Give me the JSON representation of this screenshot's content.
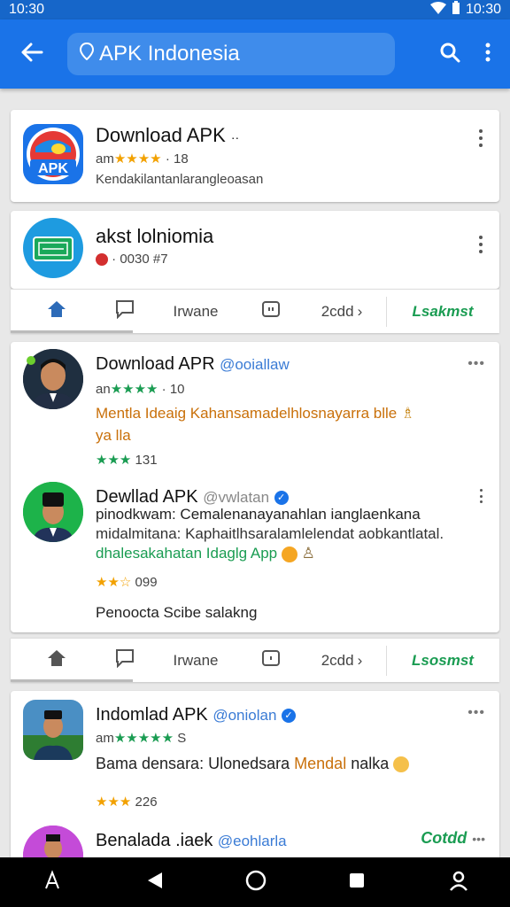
{
  "status": {
    "time_left": "10:30",
    "time_right": "10:30"
  },
  "appbar": {
    "title": "APK Indonesia"
  },
  "app_cards": [
    {
      "title": "Download APK",
      "title_suffix": "··",
      "rating_prefix": "am",
      "stars": "★★★★",
      "count": "· 18",
      "subtitle": "Kendakilantanlarangleoasan"
    },
    {
      "title": "akst lolniomia",
      "meta": "· 0030 #7"
    }
  ],
  "action_bars": [
    {
      "home": "",
      "comment": "",
      "label": "Irwane",
      "count": "2cdd",
      "green": "Lsakmst"
    },
    {
      "home": "",
      "comment": "",
      "label": "Irwane",
      "count": "2cdd",
      "green": "Lsosmst"
    }
  ],
  "posts": [
    {
      "title": "Download APR",
      "handle": "@ooiallaw",
      "rating_prefix": "an",
      "stars": "★★★★",
      "count": "· 10",
      "text": "Mentla Ideaig Kahansamadelhlosnayarra blle",
      "text2": "ya lla",
      "bottom_stars": "★★★",
      "bottom_count": "131"
    },
    {
      "title": "Dewllad APK",
      "handle": "@vwlatan",
      "text1": "pinodkwam: Cemalenanayanahlan ianglaenkana",
      "text2": "midalmitana: Kaphaitlhsaralamlelendat aobkantlatal.",
      "text3": "dhalesakahatan Idaglg App",
      "stars": "★★☆",
      "count": "099",
      "footer": "Penoocta Scibe salakng"
    },
    {
      "title": "Indomlad APK",
      "handle": "@oniolan",
      "rating_prefix": "am",
      "stars": "★★★★★",
      "count": "S",
      "text_a": "Bama densara: Ulonedsara",
      "text_b": "Mendal",
      "text_c": "nalka",
      "bottom_stars": "★★★",
      "bottom_count": "226"
    },
    {
      "title": "Benalada .iaek",
      "handle": "@eohlarla",
      "green": "Cotdd"
    }
  ],
  "colors": {
    "primary": "#1a73e8",
    "green": "#1a9c52",
    "star": "#f2a100",
    "handle": "#3a7bd5"
  },
  "icons": [
    "arrow-back-icon",
    "search-icon",
    "more-vert-icon",
    "home-icon",
    "comment-icon",
    "back-triangle-icon",
    "home-circle-icon",
    "square-icon",
    "person-icon"
  ]
}
